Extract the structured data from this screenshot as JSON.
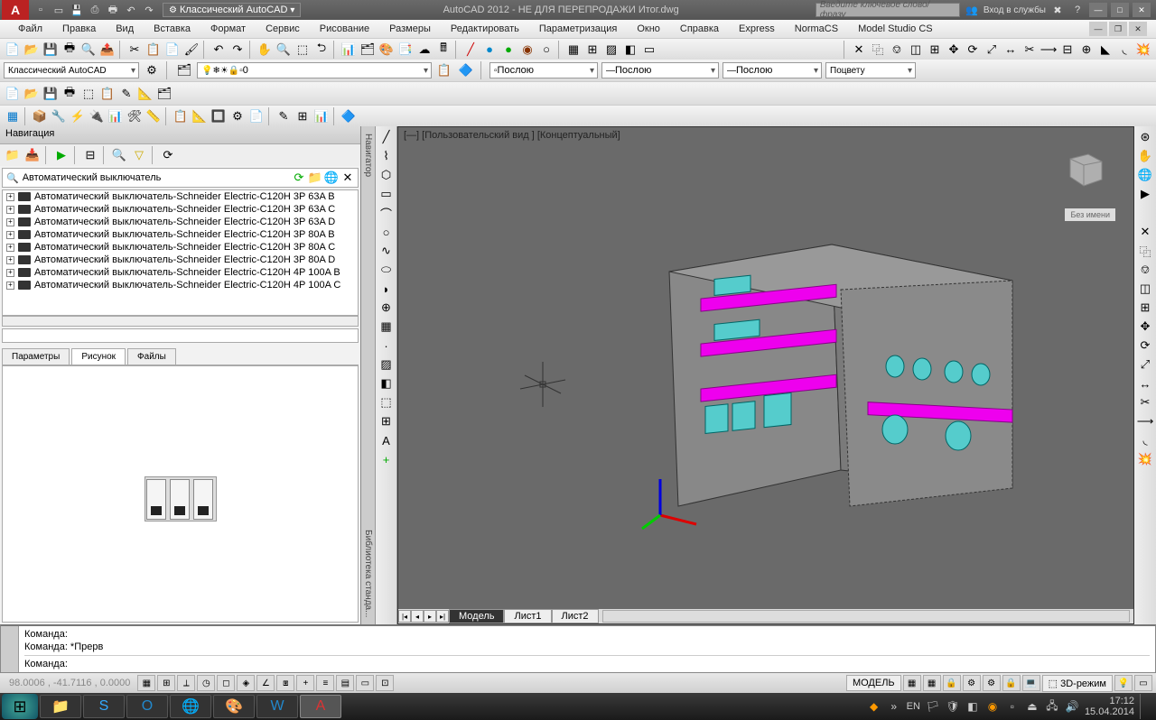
{
  "title": "AutoCAD 2012 - НЕ ДЛЯ ПЕРЕПРОДАЖИ   Итог.dwg",
  "workspace": "Классический AutoCAD",
  "search_placeholder": "Введите ключевое слово/фразу",
  "login": "Вход в службы",
  "menu": [
    "Файл",
    "Правка",
    "Вид",
    "Вставка",
    "Формат",
    "Сервис",
    "Рисование",
    "Размеры",
    "Редактировать",
    "Параметризация",
    "Окно",
    "Справка",
    "Express",
    "NormaCS",
    "Model Studio CS"
  ],
  "layer_dd1": "Классический AutoCAD",
  "layer_current": "0",
  "prop_dd1": "Послою",
  "prop_dd2": "Послою",
  "prop_dd3": "Послою",
  "prop_dd4": "Поцвету",
  "nav": {
    "title": "Навигация",
    "search": "Автоматический выключатель",
    "items": [
      "Автоматический выключатель-Schneider Electric-C120H 3P 63A B",
      "Автоматический выключатель-Schneider Electric-C120H 3P 63A C",
      "Автоматический выключатель-Schneider Electric-C120H 3P 63A D",
      "Автоматический выключатель-Schneider Electric-C120H 3P 80A B",
      "Автоматический выключатель-Schneider Electric-C120H 3P 80A C",
      "Автоматический выключатель-Schneider Electric-C120H 3P 80A D",
      "Автоматический выключатель-Schneider Electric-C120H 4P 100A B",
      "Автоматический выключатель-Schneider Electric-C120H 4P 100A C"
    ],
    "tabs": [
      "Параметры",
      "Рисунок",
      "Файлы"
    ],
    "side_label": "Библиотека станда..."
  },
  "nav_side": "Навигатор",
  "viewport": {
    "label": "[—] [Пользовательский вид ] [Концептуальный]",
    "noname": "Без имени",
    "tabs": [
      "Модель",
      "Лист1",
      "Лист2"
    ]
  },
  "cmd": {
    "l1": "Команда:",
    "l2": "Команда:  *Прерв",
    "l3": "Команда:"
  },
  "status": {
    "coords": "98.0006 , -41.7116 , 0.0000",
    "model": "МОДЕЛЬ",
    "mode3d": "3D-режим"
  },
  "tray": {
    "lang": "EN",
    "time": "17:12",
    "date": "15.04.2014"
  }
}
